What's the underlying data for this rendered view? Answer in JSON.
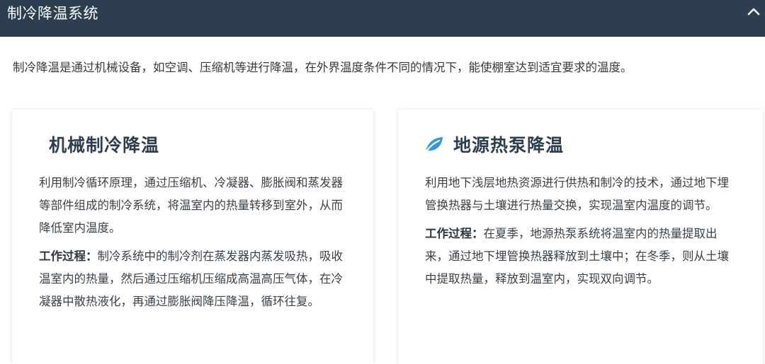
{
  "header": {
    "title": "制冷降温系统",
    "collapse_icon": "chevron-up-icon"
  },
  "intro": "制冷降温是通过机械设备，如空调、压缩机等进行降温，在外界温度条件不同的情况下，能使棚室达到适宜要求的温度。",
  "cards": [
    {
      "title": "机械制冷降温",
      "description": "利用制冷循环原理，通过压缩机、冷凝器、膨胀阀和蒸发器等部件组成的制冷系统，将温室内的热量转移到室外，从而降低室内温度。",
      "process_label": "工作过程：",
      "process_text": "制冷系统中的制冷剂在蒸发器内蒸发吸热，吸收温室内的热量，然后通过压缩机压缩成高温高压气体，在冷凝器中散热液化，再通过膨胀阀降压降温，循环往复。"
    },
    {
      "title": "地源热泵降温",
      "icon": "leaf-icon",
      "description": "利用地下浅层地热资源进行供热和制冷的技术，通过地下埋管换热器与土壤进行热量交换，实现温室内温度的调节。",
      "process_label": "工作过程：",
      "process_text": "在夏季，地源热泵系统将温室内的热量提取出来，通过地下埋管换热器释放到土壤中；在冬季，则从土壤中提取热量，释放到温室内，实现双向调节。"
    }
  ],
  "colors": {
    "header_bg": "#2c3e50",
    "title": "#2c3e50",
    "icon_accent": "#3498db"
  }
}
